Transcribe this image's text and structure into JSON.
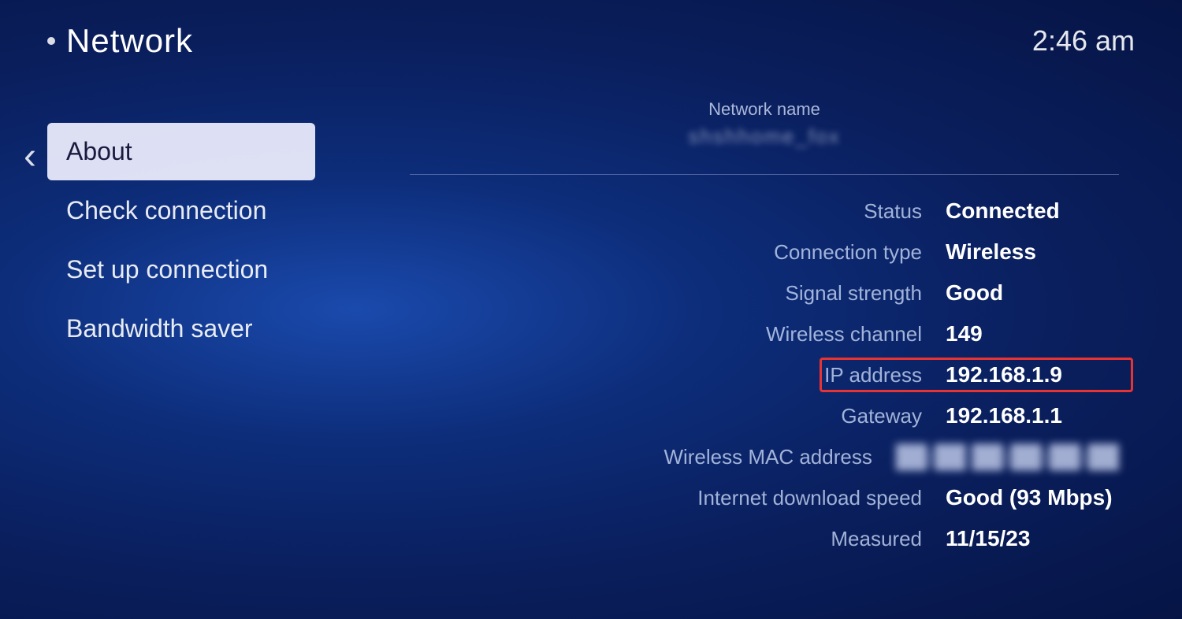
{
  "header": {
    "dot": "•",
    "title": "Network",
    "time": "2:46 am"
  },
  "sidebar": {
    "back_icon": "‹",
    "items": [
      {
        "id": "about",
        "label": "About",
        "active": true
      },
      {
        "id": "check-connection",
        "label": "Check connection",
        "active": false
      },
      {
        "id": "set-up-connection",
        "label": "Set up connection",
        "active": false
      },
      {
        "id": "bandwidth-saver",
        "label": "Bandwidth saver",
        "active": false
      }
    ]
  },
  "content": {
    "network_name_label": "Network name",
    "network_name_value": "xxxxxxxxxx",
    "rows": [
      {
        "id": "status",
        "label": "Status",
        "value": "Connected",
        "blurred": false
      },
      {
        "id": "connection-type",
        "label": "Connection type",
        "value": "Wireless",
        "blurred": false
      },
      {
        "id": "signal-strength",
        "label": "Signal strength",
        "value": "Good",
        "blurred": false
      },
      {
        "id": "wireless-channel",
        "label": "Wireless channel",
        "value": "149",
        "blurred": false
      },
      {
        "id": "ip-address",
        "label": "IP address",
        "value": "192.168.1.9",
        "blurred": false,
        "highlight": true
      },
      {
        "id": "gateway",
        "label": "Gateway",
        "value": "192.168.1.1",
        "blurred": false
      },
      {
        "id": "wireless-mac",
        "label": "Wireless MAC address",
        "value": "██:██:██:██:██:██",
        "blurred": true
      },
      {
        "id": "download-speed",
        "label": "Internet download speed",
        "value": "Good (93 Mbps)",
        "blurred": false
      },
      {
        "id": "measured",
        "label": "Measured",
        "value": "11/15/23",
        "blurred": false
      }
    ]
  }
}
